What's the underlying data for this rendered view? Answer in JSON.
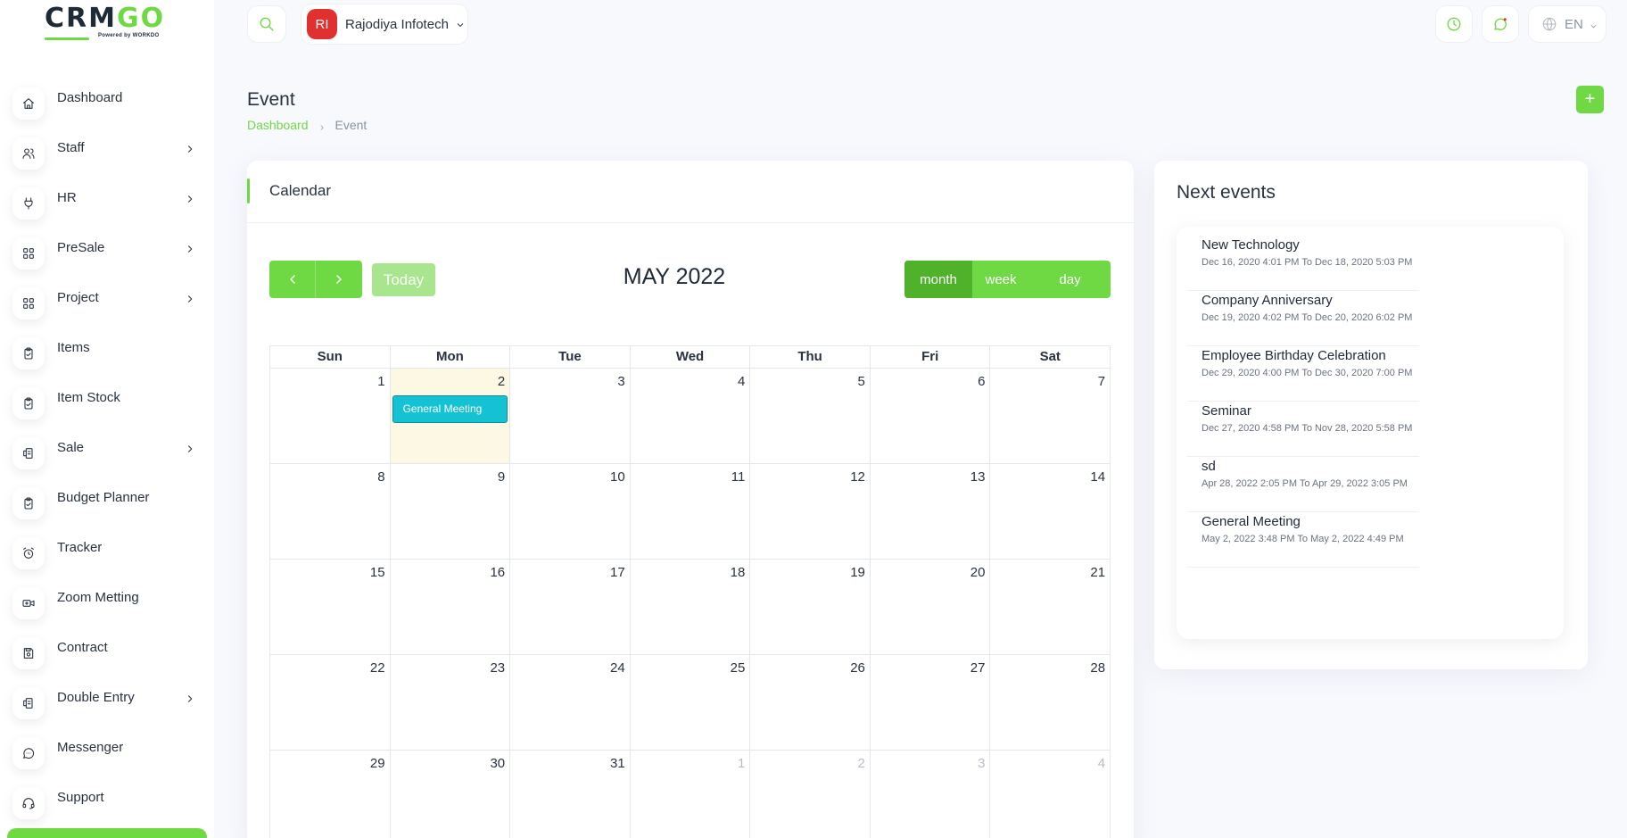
{
  "brand": {
    "logo_main": "CRM",
    "logo_go": "GO",
    "logo_sub": "Powered by WORKDO"
  },
  "sidebar": {
    "items": [
      {
        "label": "Dashboard",
        "icon": "home-icon",
        "has_children": false
      },
      {
        "label": "Staff",
        "icon": "users-icon",
        "has_children": true
      },
      {
        "label": "HR",
        "icon": "plug-icon",
        "has_children": true
      },
      {
        "label": "PreSale",
        "icon": "grid-icon",
        "has_children": true
      },
      {
        "label": "Project",
        "icon": "grid-icon",
        "has_children": true
      },
      {
        "label": "Items",
        "icon": "clipboard-icon",
        "has_children": false
      },
      {
        "label": "Item Stock",
        "icon": "clipboard-icon",
        "has_children": false
      },
      {
        "label": "Sale",
        "icon": "receipt-icon",
        "has_children": true
      },
      {
        "label": "Budget Planner",
        "icon": "clipboard-icon",
        "has_children": false
      },
      {
        "label": "Tracker",
        "icon": "alarm-icon",
        "has_children": false
      },
      {
        "label": "Zoom Metting",
        "icon": "video-icon",
        "has_children": false
      },
      {
        "label": "Contract",
        "icon": "device-floppy-icon",
        "has_children": false
      },
      {
        "label": "Double Entry",
        "icon": "receipt-icon",
        "has_children": true
      },
      {
        "label": "Messenger",
        "icon": "message-icon",
        "has_children": false
      },
      {
        "label": "Support",
        "icon": "headset-icon",
        "has_children": false
      }
    ]
  },
  "header": {
    "company_initials": "RI",
    "company_name": "Rajodiya Infotech",
    "language": "EN",
    "colors": {
      "accent": "#6fd943",
      "avatar": "#e03030"
    }
  },
  "page": {
    "title": "Event",
    "breadcrumb": [
      "Dashboard",
      "Event"
    ],
    "add_label": "+"
  },
  "calendar": {
    "card_title": "Calendar",
    "today_label": "Today",
    "month_title": "MAY 2022",
    "views": [
      {
        "label": "month",
        "active": true
      },
      {
        "label": "week",
        "active": false
      },
      {
        "label": "day",
        "active": false
      }
    ],
    "weekdays": [
      "Sun",
      "Mon",
      "Tue",
      "Wed",
      "Thu",
      "Fri",
      "Sat"
    ],
    "weeks": [
      [
        {
          "d": "1"
        },
        {
          "d": "2",
          "today": true,
          "event": "General Meeting"
        },
        {
          "d": "3"
        },
        {
          "d": "4"
        },
        {
          "d": "5"
        },
        {
          "d": "6"
        },
        {
          "d": "7"
        }
      ],
      [
        {
          "d": "8"
        },
        {
          "d": "9"
        },
        {
          "d": "10"
        },
        {
          "d": "11"
        },
        {
          "d": "12"
        },
        {
          "d": "13"
        },
        {
          "d": "14"
        }
      ],
      [
        {
          "d": "15"
        },
        {
          "d": "16"
        },
        {
          "d": "17"
        },
        {
          "d": "18"
        },
        {
          "d": "19"
        },
        {
          "d": "20"
        },
        {
          "d": "21"
        }
      ],
      [
        {
          "d": "22"
        },
        {
          "d": "23"
        },
        {
          "d": "24"
        },
        {
          "d": "25"
        },
        {
          "d": "26"
        },
        {
          "d": "27"
        },
        {
          "d": "28"
        }
      ],
      [
        {
          "d": "29"
        },
        {
          "d": "30"
        },
        {
          "d": "31"
        },
        {
          "d": "1",
          "other": true
        },
        {
          "d": "2",
          "other": true
        },
        {
          "d": "3",
          "other": true
        },
        {
          "d": "4",
          "other": true
        }
      ]
    ],
    "event_color": "#14c2d4",
    "today_color": "#fcf8e3"
  },
  "next_events": {
    "title": "Next events",
    "items": [
      {
        "name": "New Technology",
        "date": "Dec 16, 2020 4:01 PM To Dec 18, 2020 5:03 PM"
      },
      {
        "name": "Company Anniversary",
        "date": "Dec 19, 2020 4:02 PM To Dec 20, 2020 6:02 PM"
      },
      {
        "name": "Employee Birthday Celebration",
        "date": "Dec 29, 2020 4:00 PM To Dec 30, 2020 7:00 PM"
      },
      {
        "name": "Seminar",
        "date": "Dec 27, 2020 4:58 PM To Nov 28, 2020 5:58 PM"
      },
      {
        "name": "sd",
        "date": "Apr 28, 2022 2:05 PM To Apr 29, 2022 3:05 PM"
      },
      {
        "name": "General Meeting",
        "date": "May 2, 2022 3:48 PM To May 2, 2022 4:49 PM"
      }
    ]
  }
}
